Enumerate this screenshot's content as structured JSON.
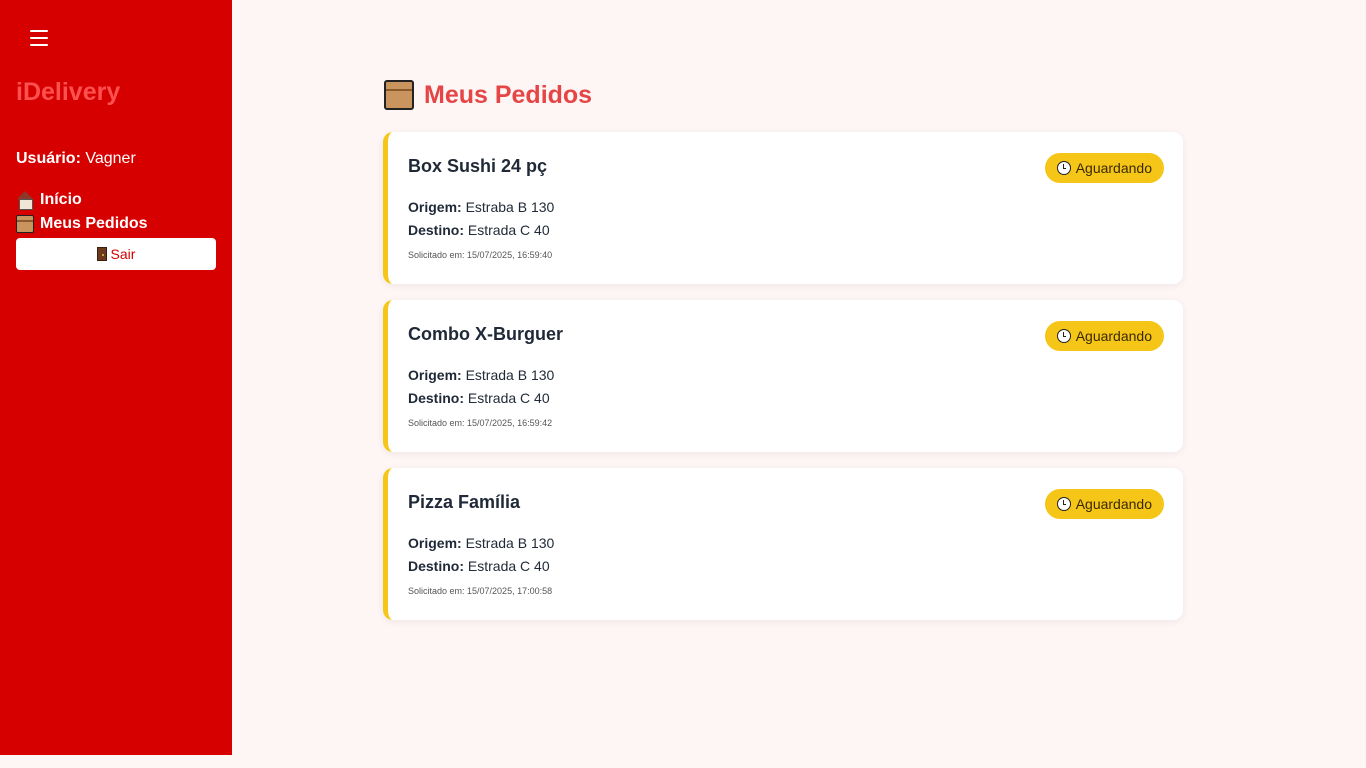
{
  "sidebar": {
    "brand": "iDelivery",
    "user_label": "Usuário:",
    "user_name": "Vagner",
    "nav": [
      {
        "label": "Início",
        "icon": "house-icon"
      },
      {
        "label": "Meus Pedidos",
        "icon": "package-icon"
      }
    ],
    "logout_label": "Sair",
    "logout_icon": "door-icon",
    "bg_color": "#d60000"
  },
  "main": {
    "title": "Meus Pedidos",
    "title_icon": "package-icon",
    "title_color": "#e54545",
    "origin_label": "Origem:",
    "destination_label": "Destino:",
    "orders": [
      {
        "title": "Box Sushi 24 pç",
        "status": "Aguardando",
        "origin": "Estraba B 130",
        "destination": "Estrada C 40",
        "requested": "Solicitado em: 15/07/2025, 16:59:40"
      },
      {
        "title": "Combo X-Burguer",
        "status": "Aguardando",
        "origin": "Estrada B 130",
        "destination": "Estrada C 40",
        "requested": "Solicitado em: 15/07/2025, 16:59:42"
      },
      {
        "title": "Pizza Família",
        "status": "Aguardando",
        "origin": "Estrada B 130",
        "destination": "Estrada C 40",
        "requested": "Solicitado em: 15/07/2025, 17:00:58"
      }
    ],
    "status_color": "#f5c518"
  }
}
